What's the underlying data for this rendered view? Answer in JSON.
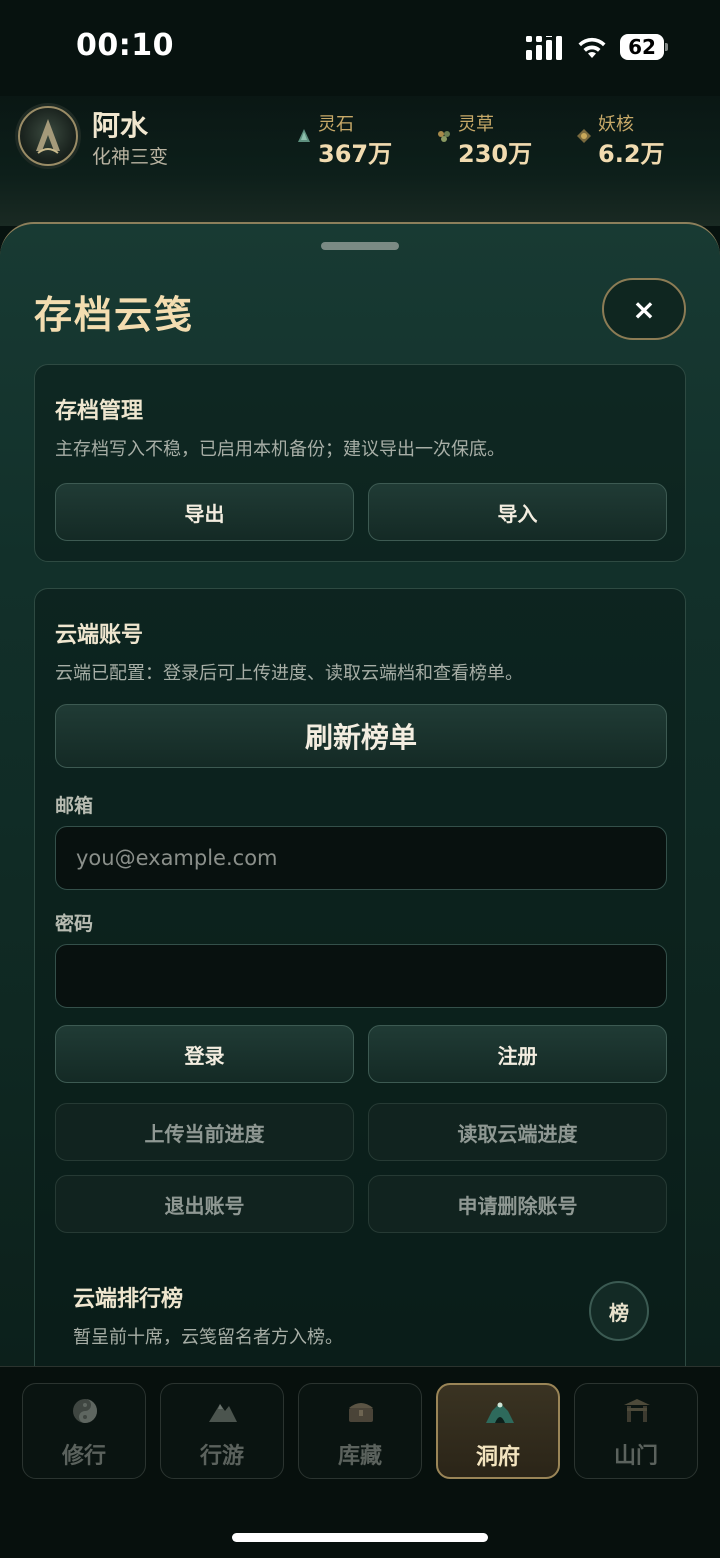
{
  "status": {
    "time": "00:10",
    "battery": "62"
  },
  "player": {
    "name": "阿水",
    "rank": "化神三变"
  },
  "resources": [
    {
      "label": "灵石",
      "value": "367万",
      "icon": "spirit-stone-icon"
    },
    {
      "label": "灵草",
      "value": "230万",
      "icon": "spirit-herb-icon"
    },
    {
      "label": "妖核",
      "value": "6.2万",
      "icon": "demon-core-icon"
    }
  ],
  "sheet": {
    "title": "存档云笺",
    "close_label": "×",
    "save_mgmt": {
      "title": "存档管理",
      "desc": "主存档写入不稳，已启用本机备份；建议导出一次保底。",
      "export_label": "导出",
      "import_label": "导入"
    },
    "cloud": {
      "title": "云端账号",
      "desc": "云端已配置：登录后可上传进度、读取云端档和查看榜单。",
      "refresh_label": "刷新榜单",
      "email_label": "邮箱",
      "email_placeholder": "you@example.com",
      "password_label": "密码",
      "login_label": "登录",
      "register_label": "注册",
      "upload_label": "上传当前进度",
      "download_label": "读取云端进度",
      "logout_label": "退出账号",
      "delete_label": "申请删除账号"
    },
    "leaderboard": {
      "title": "云端排行榜",
      "desc": "暂呈前十席，云笺留名者方入榜。",
      "badge": "榜"
    }
  },
  "nav": [
    {
      "label": "修行",
      "icon": "yin-yang-icon",
      "active": false
    },
    {
      "label": "行游",
      "icon": "mountain-icon",
      "active": false
    },
    {
      "label": "库藏",
      "icon": "chest-icon",
      "active": false
    },
    {
      "label": "洞府",
      "icon": "cave-icon",
      "active": true
    },
    {
      "label": "山门",
      "icon": "gate-icon",
      "active": false
    }
  ],
  "colors": {
    "accent_gold": "#f3ddb0",
    "sheet_bg": "#12302a",
    "active_tab_border": "#9a8557"
  }
}
